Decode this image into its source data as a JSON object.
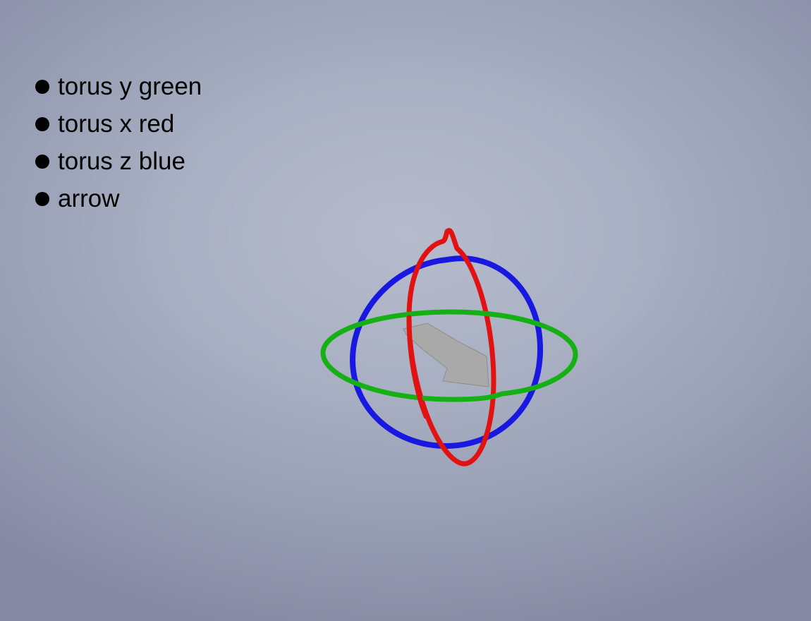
{
  "bullets": [
    {
      "label": "torus y green"
    },
    {
      "label": "torus x red"
    },
    {
      "label": "torus z blue"
    },
    {
      "label": "arrow"
    }
  ],
  "gizmo": {
    "ring_colors": {
      "x": "#e11212",
      "y": "#14b014",
      "z": "#1818e0"
    },
    "arrow_color": "#a9a9a9"
  }
}
